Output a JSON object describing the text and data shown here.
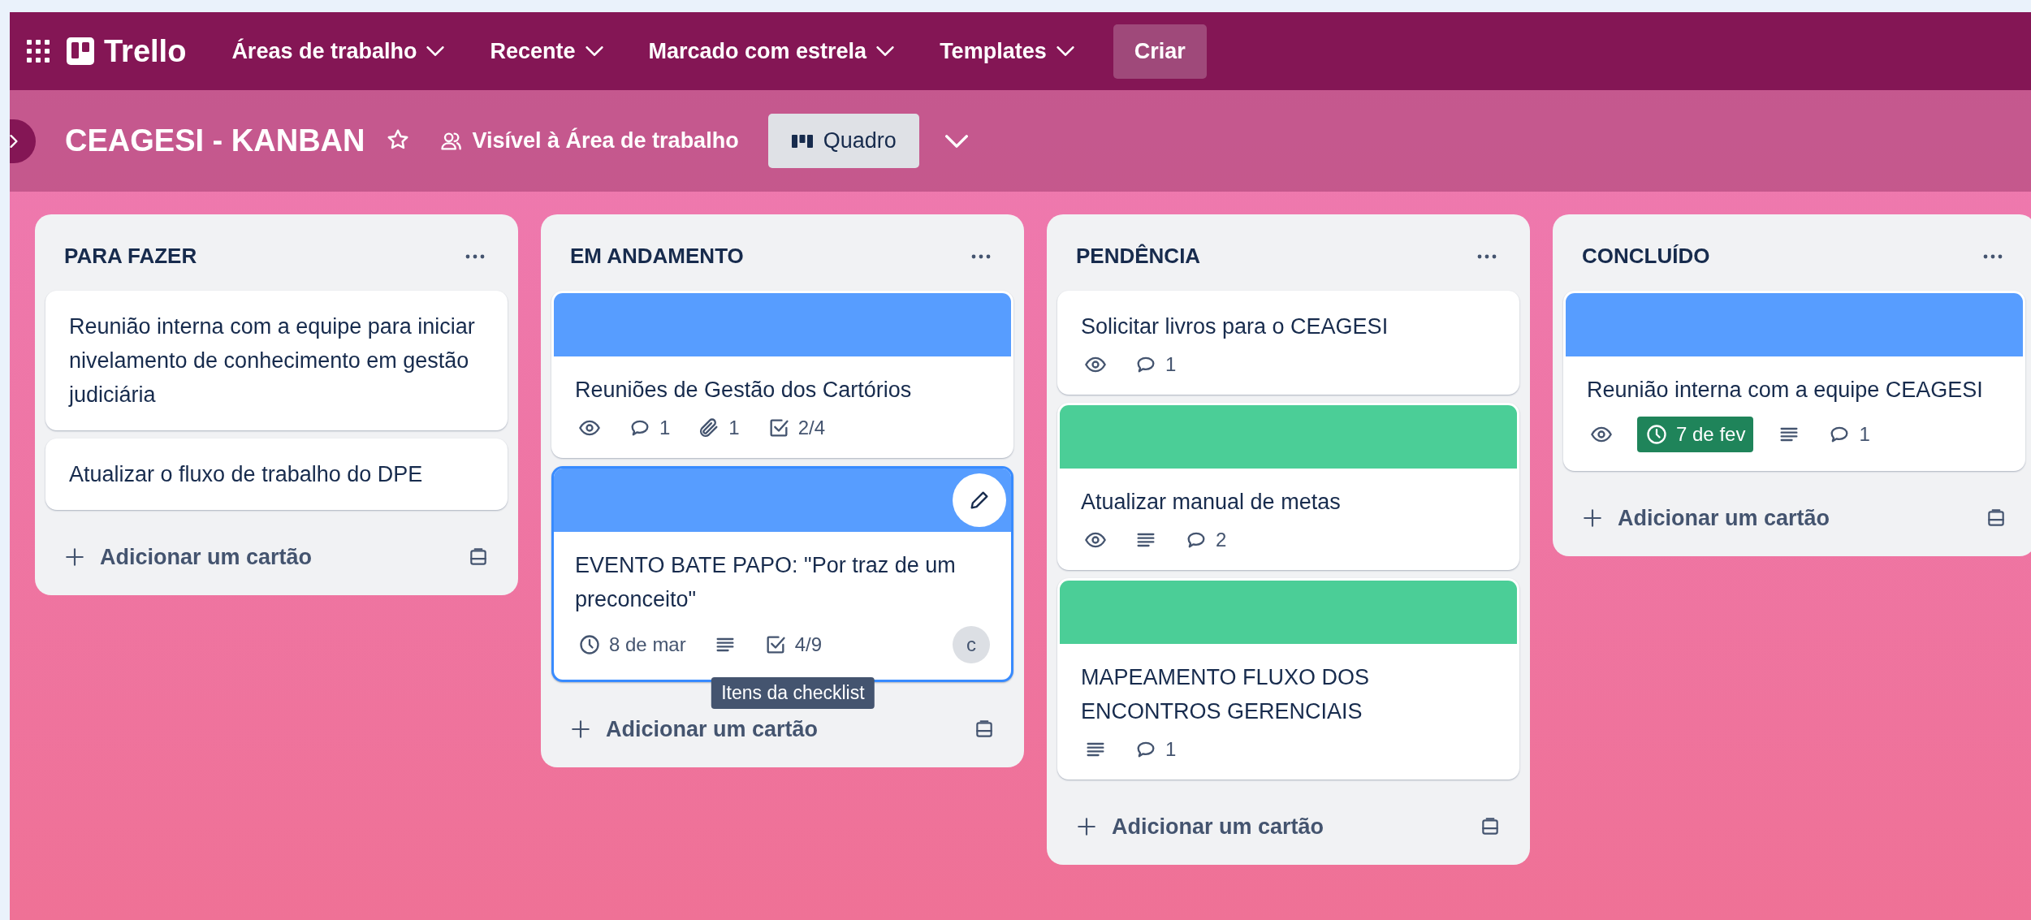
{
  "nav": {
    "logo": "Trello",
    "menus": [
      {
        "label": "Áreas de trabalho"
      },
      {
        "label": "Recente"
      },
      {
        "label": "Marcado com estrela"
      },
      {
        "label": "Templates"
      }
    ],
    "create": "Criar"
  },
  "board": {
    "title": "CEAGESI - KANBAN",
    "starred": false,
    "visibility": "Visível à Área de trabalho",
    "view": "Quadro"
  },
  "lists": [
    {
      "title": "PARA FAZER",
      "add_label": "Adicionar um cartão",
      "cards": [
        {
          "title": "Reunião interna com a equipe para iniciar nivelamento de conhecimento em gestão judiciária",
          "hovered": false
        },
        {
          "title": "Atualizar o fluxo de trabalho do DPE",
          "hovered": false
        }
      ]
    },
    {
      "title": "EM ANDAMENTO",
      "add_label": "Adicionar um cartão",
      "cards": [
        {
          "title": "Reuniões de Gestão dos Cartórios",
          "color": "#579dff",
          "hovered": false,
          "badges": [
            {
              "kind": "watch"
            },
            {
              "kind": "comments",
              "text": "1"
            },
            {
              "kind": "attachments",
              "text": "1"
            },
            {
              "kind": "checklist",
              "text": "2/4"
            }
          ]
        },
        {
          "title": "EVENTO BATE PAPO: \"Por traz de um preconceito\"",
          "color": "#579dff",
          "hovered": true,
          "badges": [
            {
              "kind": "due",
              "text": "8 de mar",
              "complete": false
            },
            {
              "kind": "description"
            },
            {
              "kind": "checklist",
              "text": "4/9",
              "tooltip": "Itens da checklist"
            }
          ],
          "members": [
            {
              "initial": "c"
            }
          ]
        }
      ]
    },
    {
      "title": "PENDÊNCIA",
      "add_label": "Adicionar um cartão",
      "cards": [
        {
          "title": "Solicitar livros para o CEAGESI",
          "hovered": false,
          "badges": [
            {
              "kind": "watch"
            },
            {
              "kind": "comments",
              "text": "1"
            }
          ]
        },
        {
          "title": "Atualizar manual de metas",
          "color": "#4bce97",
          "hovered": false,
          "badges": [
            {
              "kind": "watch"
            },
            {
              "kind": "description"
            },
            {
              "kind": "comments",
              "text": "2"
            }
          ]
        },
        {
          "title": "MAPEAMENTO FLUXO DOS ENCONTROS GERENCIAIS",
          "color": "#4bce97",
          "hovered": false,
          "badges": [
            {
              "kind": "description"
            },
            {
              "kind": "comments",
              "text": "1"
            }
          ]
        }
      ]
    },
    {
      "title": "CONCLUÍDO",
      "add_label": "Adicionar um cartão",
      "cards": [
        {
          "title": "Reunião interna com a equipe CEAGESI",
          "color": "#579dff",
          "hovered": false,
          "badges": [
            {
              "kind": "watch"
            },
            {
              "kind": "due",
              "text": "7 de fev",
              "complete": true
            },
            {
              "kind": "description"
            },
            {
              "kind": "comments",
              "text": "1"
            }
          ]
        }
      ]
    }
  ]
}
